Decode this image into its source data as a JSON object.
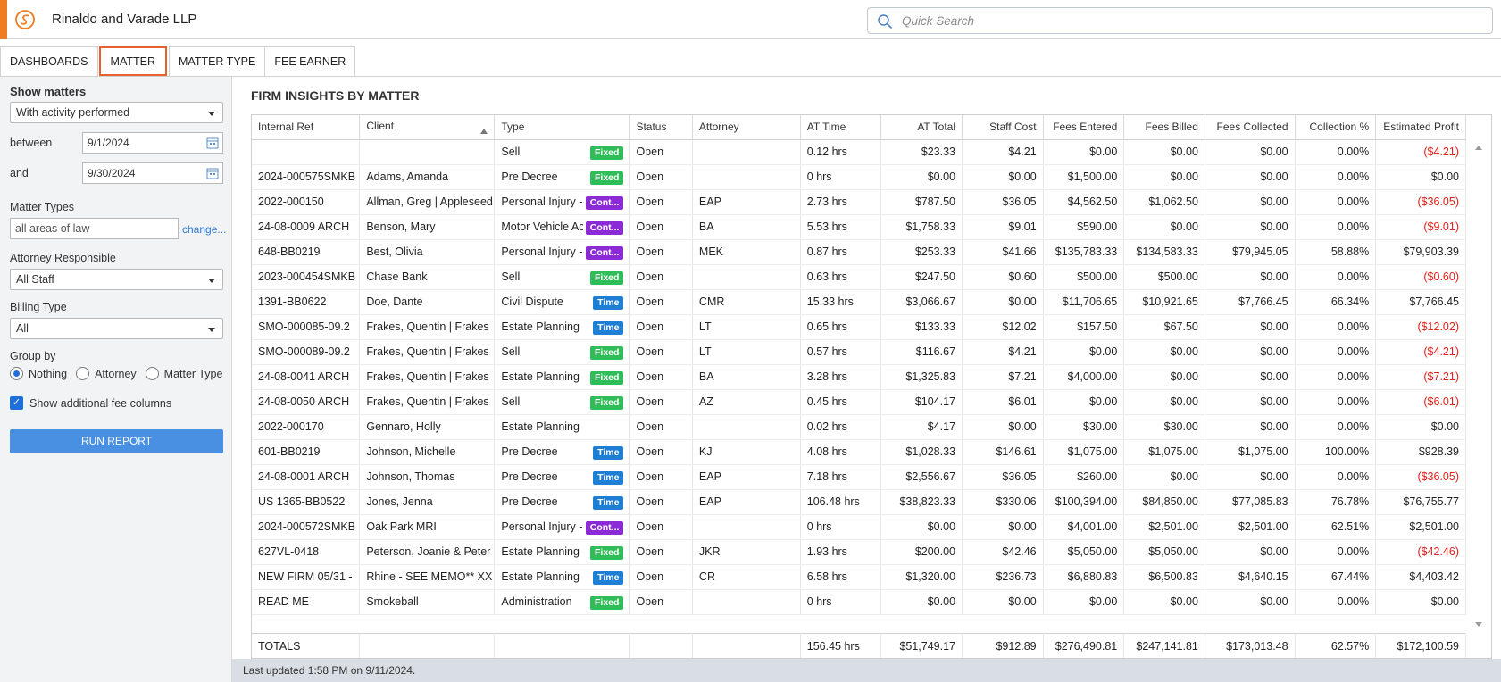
{
  "app": {
    "firm_name": "Rinaldo and Varade LLP",
    "accent": "#f07c22"
  },
  "search": {
    "placeholder": "Quick Search"
  },
  "tabs": [
    "DASHBOARDS",
    "MATTER",
    "MATTER TYPE",
    "FEE EARNER"
  ],
  "sidebar": {
    "show_matters_label": "Show matters",
    "show_matters_value": "With activity performed",
    "between_label": "between",
    "between_value": "9/1/2024",
    "and_label": "and",
    "and_value": "9/30/2024",
    "matter_types_label": "Matter Types",
    "matter_types_value": "all areas of law",
    "change_link": "change...",
    "attorney_label": "Attorney Responsible",
    "attorney_value": "All Staff",
    "billing_label": "Billing Type",
    "billing_value": "All",
    "group_by_label": "Group by",
    "group_options": [
      "Nothing",
      "Attorney",
      "Matter Type"
    ],
    "group_selected": "Nothing",
    "show_fee_columns_label": "Show additional fee columns",
    "run_report_label": "RUN REPORT"
  },
  "main": {
    "title": "FIRM INSIGHTS BY MATTER",
    "columns": [
      "Internal Ref",
      "Client",
      "Type",
      "Status",
      "Attorney",
      "AT Time",
      "AT Total",
      "Staff Cost",
      "Fees Entered",
      "Fees Billed",
      "Fees Collected",
      "Collection %",
      "Estimated Profit"
    ],
    "rows": [
      [
        "",
        "",
        "Sell",
        "Fixed",
        "Open",
        "",
        "0.12 hrs",
        "$23.33",
        "$4.21",
        "$0.00",
        "$0.00",
        "$0.00",
        "0.00%",
        "($4.21)"
      ],
      [
        "2024-000575SMKB",
        "Adams, Amanda",
        "Pre Decree",
        "Fixed",
        "Open",
        "",
        "0 hrs",
        "$0.00",
        "$0.00",
        "$1,500.00",
        "$0.00",
        "$0.00",
        "0.00%",
        "$0.00"
      ],
      [
        "2022-000150",
        "Allman, Greg | Appleseed",
        "Personal Injury - MVA",
        "Cont...",
        "Open",
        "EAP",
        "2.73 hrs",
        "$787.50",
        "$36.05",
        "$4,562.50",
        "$1,062.50",
        "$0.00",
        "0.00%",
        "($36.05)"
      ],
      [
        "24-08-0009 ARCH",
        "Benson, Mary",
        "Motor Vehicle Accident",
        "Cont...",
        "Open",
        "BA",
        "5.53 hrs",
        "$1,758.33",
        "$9.01",
        "$590.00",
        "$0.00",
        "$0.00",
        "0.00%",
        "($9.01)"
      ],
      [
        "648-BB0219",
        "Best, Olivia",
        "Personal Injury - MVA",
        "Cont...",
        "Open",
        "MEK",
        "0.87 hrs",
        "$253.33",
        "$41.66",
        "$135,783.33",
        "$134,583.33",
        "$79,945.05",
        "58.88%",
        "$79,903.39"
      ],
      [
        "2023-000454SMKB",
        "Chase Bank",
        "Sell",
        "Fixed",
        "Open",
        "",
        "0.63 hrs",
        "$247.50",
        "$0.60",
        "$500.00",
        "$500.00",
        "$0.00",
        "0.00%",
        "($0.60)"
      ],
      [
        "1391-BB0622",
        "Doe, Dante",
        "Civil Dispute",
        "Time",
        "Open",
        "CMR",
        "15.33 hrs",
        "$3,066.67",
        "$0.00",
        "$11,706.65",
        "$10,921.65",
        "$7,766.45",
        "66.34%",
        "$7,766.45"
      ],
      [
        "SMO-000085-09.2",
        "Frakes, Quentin | Frakes",
        "Estate Planning - OH",
        "Time",
        "Open",
        "LT",
        "0.65 hrs",
        "$133.33",
        "$12.02",
        "$157.50",
        "$67.50",
        "$0.00",
        "0.00%",
        "($12.02)"
      ],
      [
        "SMO-000089-09.2",
        "Frakes, Quentin | Frakes",
        "Sell",
        "Fixed",
        "Open",
        "LT",
        "0.57 hrs",
        "$116.67",
        "$4.21",
        "$0.00",
        "$0.00",
        "$0.00",
        "0.00%",
        "($4.21)"
      ],
      [
        "24-08-0041 ARCH",
        "Frakes, Quentin | Frakes",
        "Estate Planning - OH",
        "Fixed",
        "Open",
        "BA",
        "3.28 hrs",
        "$1,325.83",
        "$7.21",
        "$4,000.00",
        "$0.00",
        "$0.00",
        "0.00%",
        "($7.21)"
      ],
      [
        "24-08-0050 ARCH",
        "Frakes, Quentin | Frakes",
        "Sell",
        "Fixed",
        "Open",
        "AZ",
        "0.45 hrs",
        "$104.17",
        "$6.01",
        "$0.00",
        "$0.00",
        "$0.00",
        "0.00%",
        "($6.01)"
      ],
      [
        "2022-000170",
        "Gennaro, Holly",
        "Estate Planning - OH",
        "",
        "Open",
        "",
        "0.02 hrs",
        "$4.17",
        "$0.00",
        "$30.00",
        "$30.00",
        "$0.00",
        "0.00%",
        "$0.00"
      ],
      [
        "601-BB0219",
        "Johnson, Michelle",
        "Pre Decree",
        "Time",
        "Open",
        "KJ",
        "4.08 hrs",
        "$1,028.33",
        "$146.61",
        "$1,075.00",
        "$1,075.00",
        "$1,075.00",
        "100.00%",
        "$928.39"
      ],
      [
        "24-08-0001 ARCH",
        "Johnson, Thomas",
        "Pre Decree",
        "Time",
        "Open",
        "EAP",
        "7.18 hrs",
        "$2,556.67",
        "$36.05",
        "$260.00",
        "$0.00",
        "$0.00",
        "0.00%",
        "($36.05)"
      ],
      [
        "US 1365-BB0522",
        "Jones, Jenna",
        "Pre Decree",
        "Time",
        "Open",
        "EAP",
        "106.48 hrs",
        "$38,823.33",
        "$330.06",
        "$100,394.00",
        "$84,850.00",
        "$77,085.83",
        "76.78%",
        "$76,755.77"
      ],
      [
        "2024-000572SMKB",
        "Oak Park MRI",
        "Personal Injury - MVA",
        "Cont...",
        "Open",
        "",
        "0 hrs",
        "$0.00",
        "$0.00",
        "$4,001.00",
        "$2,501.00",
        "$2,501.00",
        "62.51%",
        "$2,501.00"
      ],
      [
        "627VL-0418",
        "Peterson, Joanie & Peter",
        "Estate Planning - OH",
        "Fixed",
        "Open",
        "JKR",
        "1.93 hrs",
        "$200.00",
        "$42.46",
        "$5,050.00",
        "$5,050.00",
        "$0.00",
        "0.00%",
        "($42.46)"
      ],
      [
        "NEW FIRM 05/31 -",
        "Rhine - SEE MEMO** XX",
        "Estate Planning - OH",
        "Time",
        "Open",
        "CR",
        "6.58 hrs",
        "$1,320.00",
        "$236.73",
        "$6,880.83",
        "$6,500.83",
        "$4,640.15",
        "67.44%",
        "$4,403.42"
      ],
      [
        "READ ME",
        "Smokeball",
        "Administration",
        "Fixed",
        "Open",
        "",
        "0 hrs",
        "$0.00",
        "$0.00",
        "$0.00",
        "$0.00",
        "$0.00",
        "0.00%",
        "$0.00"
      ]
    ],
    "totals": [
      "TOTALS",
      "",
      "",
      "",
      "",
      "156.45 hrs",
      "$51,749.17",
      "$912.89",
      "$276,490.81",
      "$247,141.81",
      "$173,013.48",
      "62.57%",
      "$172,100.59"
    ]
  },
  "status": {
    "last_updated": "Last updated 1:58 PM on 9/11/2024."
  },
  "colors": {
    "fixed": "#2ebd59",
    "time": "#1f7fd4",
    "cont": "#8a2bd6",
    "negative": "#e0201a",
    "button": "#4a90e2"
  }
}
